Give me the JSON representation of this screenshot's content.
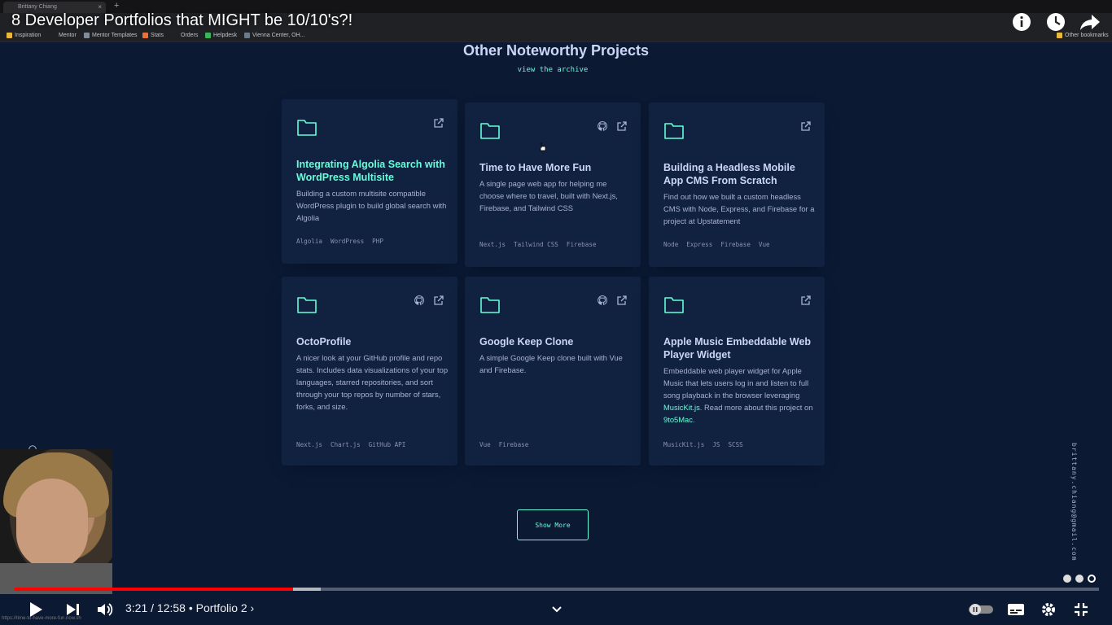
{
  "browser": {
    "tab_title": "Brittany Chiang",
    "new_tab": "+",
    "bookmarks": [
      "Inspiration",
      "Mentor",
      "Mentor Templates",
      "Stats",
      "Orders",
      "Helpdesk",
      "Vienna Center, OH..."
    ],
    "other_bookmarks": "Other bookmarks"
  },
  "video": {
    "title": "8 Developer Portfolios that MIGHT be 10/10's?!",
    "time": "3:21 / 12:58",
    "chapter": "• Portfolio 2 ›",
    "played_fraction": 0.257,
    "status_url": "https://time-to-have-more-fun.now.sh"
  },
  "page": {
    "section_title": "Other Noteworthy Projects",
    "archive_link": "view the archive",
    "show_more": "Show More",
    "email": "brittany.chiang@gmail.com"
  },
  "projects": [
    {
      "title": "Integrating Algolia Search with WordPress Multisite",
      "desc": "Building a custom multisite compatible WordPress plugin to build global search with Algolia",
      "tags": [
        "Algolia",
        "WordPress",
        "PHP"
      ],
      "github": false
    },
    {
      "title": "Time to Have More Fun",
      "desc": "A single page web app for helping me choose where to travel, built with Next.js, Firebase, and Tailwind CSS",
      "tags": [
        "Next.js",
        "Tailwind CSS",
        "Firebase"
      ],
      "github": true
    },
    {
      "title": "Building a Headless Mobile App CMS From Scratch",
      "desc": "Find out how we built a custom headless CMS with Node, Express, and Firebase for a project at Upstatement",
      "tags": [
        "Node",
        "Express",
        "Firebase",
        "Vue"
      ],
      "github": false
    },
    {
      "title": "OctoProfile",
      "desc": "A nicer look at your GitHub profile and repo stats. Includes data visualizations of your top languages, starred repositories, and sort through your top repos by number of stars, forks, and size.",
      "tags": [
        "Next.js",
        "Chart.js",
        "GitHub API"
      ],
      "github": true
    },
    {
      "title": "Google Keep Clone",
      "desc": "A simple Google Keep clone built with Vue and Firebase.",
      "tags": [
        "Vue",
        "Firebase"
      ],
      "github": true
    },
    {
      "title": "Apple Music Embeddable Web Player Widget",
      "desc_parts": [
        "Embeddable web player widget for Apple Music that lets users log in and listen to full song playback in the browser leveraging ",
        "MusicKit.js",
        ". Read more about this project on ",
        "9to5Mac",
        "."
      ],
      "tags": [
        "MusicKit.js",
        "JS",
        "SCSS"
      ],
      "github": false
    }
  ],
  "colors": {
    "background": "#0b1933",
    "card": "#112240",
    "accent": "#64ffda",
    "heading": "#ccd6f6",
    "text": "#a8b2d1",
    "progress": "#ff0000"
  }
}
